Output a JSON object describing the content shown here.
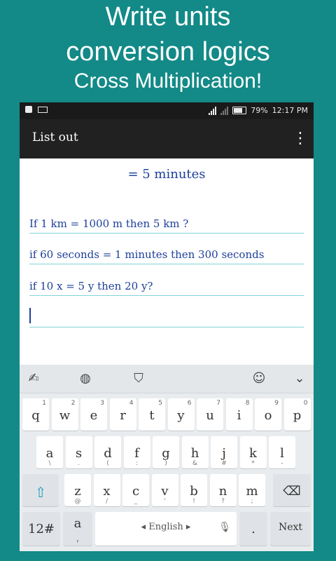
{
  "promo": {
    "line1": "Write units",
    "line2": "conversion logics",
    "line3": "Cross Multiplication!"
  },
  "status_bar": {
    "battery": "79%",
    "time": "12:17 PM",
    "signal_icon": "signal-icon",
    "battery_icon": "battery-icon"
  },
  "app_bar": {
    "title": "List out",
    "menu_icon": "overflow-menu-icon"
  },
  "content": {
    "result": "= 5 minutes",
    "lines": [
      "If 1 km = 1000 m then 5 km ?",
      "if 60 seconds = 1 minutes then 300 seconds",
      "if 10 x = 5 y then 20 y?"
    ]
  },
  "keyboard": {
    "toolbar_icons": [
      "handwriting-icon",
      "globe-icon",
      "theme-shirt-icon",
      "emoji-icon",
      "collapse-icon"
    ],
    "row1": [
      {
        "key": "q",
        "sub": "1"
      },
      {
        "key": "w",
        "sub": "2"
      },
      {
        "key": "e",
        "sub": "3"
      },
      {
        "key": "r",
        "sub": "4"
      },
      {
        "key": "t",
        "sub": "5"
      },
      {
        "key": "y",
        "sub": "6"
      },
      {
        "key": "u",
        "sub": "7"
      },
      {
        "key": "i",
        "sub": "8"
      },
      {
        "key": "o",
        "sub": "9"
      },
      {
        "key": "p",
        "sub": "0"
      }
    ],
    "row2": [
      {
        "key": "a",
        "below": "\\"
      },
      {
        "key": "s",
        "below": "."
      },
      {
        "key": "d",
        "below": "("
      },
      {
        "key": "f",
        "below": ":"
      },
      {
        "key": "g",
        "below": ")"
      },
      {
        "key": "h",
        "below": "&"
      },
      {
        "key": "j",
        "below": "#"
      },
      {
        "key": "k",
        "below": "*"
      },
      {
        "key": "l",
        "below": "-"
      }
    ],
    "row3": [
      {
        "key": "z",
        "below": "@"
      },
      {
        "key": "x",
        "below": "/"
      },
      {
        "key": "c",
        "below": "_"
      },
      {
        "key": "v",
        "below": "'"
      },
      {
        "key": "b",
        "below": "!"
      },
      {
        "key": "n",
        "below": "?"
      },
      {
        "key": "m",
        "below": ";"
      }
    ],
    "num_label": "12#",
    "space_label": "English",
    "period_label": ".",
    "enter_label": "Next",
    "comma_key": {
      "top": "a",
      "below": ","
    }
  }
}
